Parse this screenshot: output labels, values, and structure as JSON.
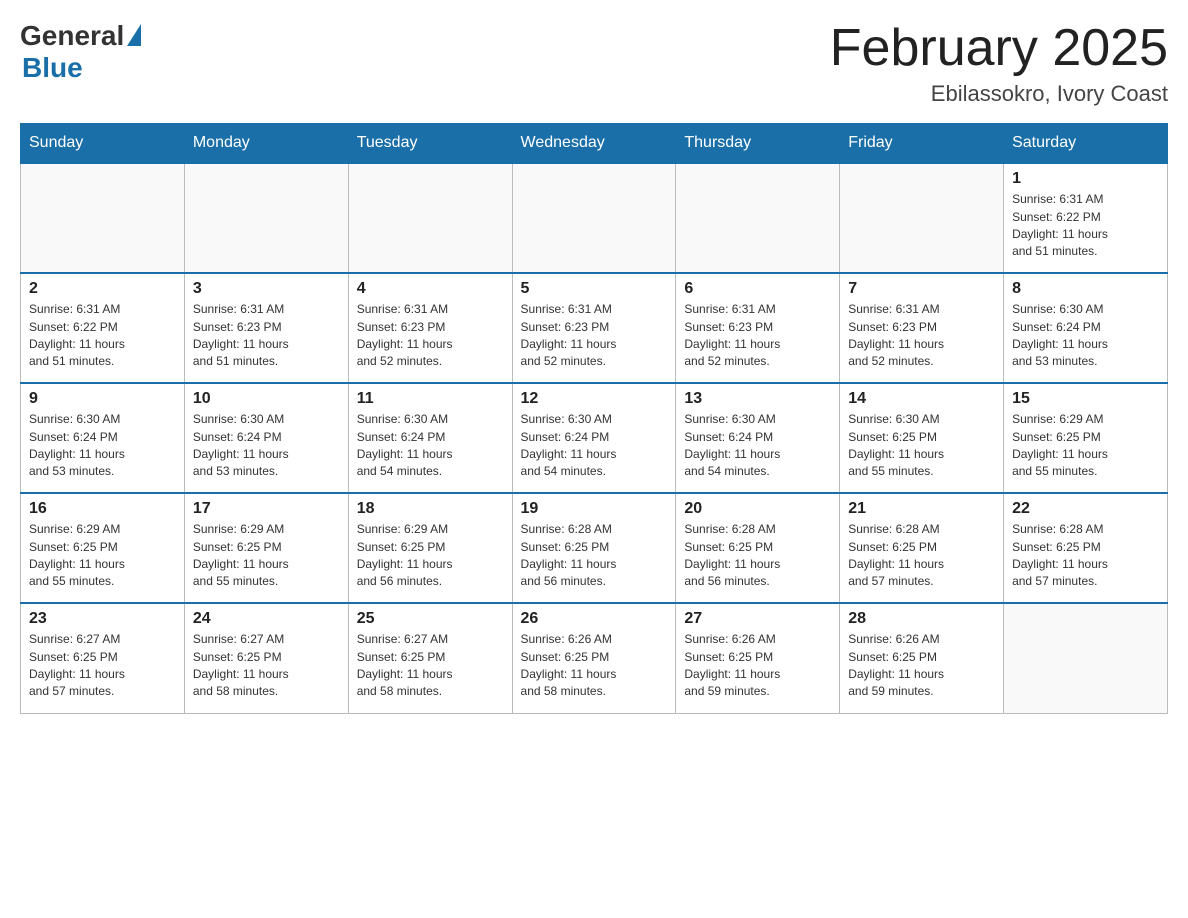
{
  "header": {
    "logo_general": "General",
    "logo_blue": "Blue",
    "month_title": "February 2025",
    "location": "Ebilassokro, Ivory Coast"
  },
  "days_of_week": [
    "Sunday",
    "Monday",
    "Tuesday",
    "Wednesday",
    "Thursday",
    "Friday",
    "Saturday"
  ],
  "weeks": [
    [
      {
        "day": "",
        "info": ""
      },
      {
        "day": "",
        "info": ""
      },
      {
        "day": "",
        "info": ""
      },
      {
        "day": "",
        "info": ""
      },
      {
        "day": "",
        "info": ""
      },
      {
        "day": "",
        "info": ""
      },
      {
        "day": "1",
        "info": "Sunrise: 6:31 AM\nSunset: 6:22 PM\nDaylight: 11 hours\nand 51 minutes."
      }
    ],
    [
      {
        "day": "2",
        "info": "Sunrise: 6:31 AM\nSunset: 6:22 PM\nDaylight: 11 hours\nand 51 minutes."
      },
      {
        "day": "3",
        "info": "Sunrise: 6:31 AM\nSunset: 6:23 PM\nDaylight: 11 hours\nand 51 minutes."
      },
      {
        "day": "4",
        "info": "Sunrise: 6:31 AM\nSunset: 6:23 PM\nDaylight: 11 hours\nand 52 minutes."
      },
      {
        "day": "5",
        "info": "Sunrise: 6:31 AM\nSunset: 6:23 PM\nDaylight: 11 hours\nand 52 minutes."
      },
      {
        "day": "6",
        "info": "Sunrise: 6:31 AM\nSunset: 6:23 PM\nDaylight: 11 hours\nand 52 minutes."
      },
      {
        "day": "7",
        "info": "Sunrise: 6:31 AM\nSunset: 6:23 PM\nDaylight: 11 hours\nand 52 minutes."
      },
      {
        "day": "8",
        "info": "Sunrise: 6:30 AM\nSunset: 6:24 PM\nDaylight: 11 hours\nand 53 minutes."
      }
    ],
    [
      {
        "day": "9",
        "info": "Sunrise: 6:30 AM\nSunset: 6:24 PM\nDaylight: 11 hours\nand 53 minutes."
      },
      {
        "day": "10",
        "info": "Sunrise: 6:30 AM\nSunset: 6:24 PM\nDaylight: 11 hours\nand 53 minutes."
      },
      {
        "day": "11",
        "info": "Sunrise: 6:30 AM\nSunset: 6:24 PM\nDaylight: 11 hours\nand 54 minutes."
      },
      {
        "day": "12",
        "info": "Sunrise: 6:30 AM\nSunset: 6:24 PM\nDaylight: 11 hours\nand 54 minutes."
      },
      {
        "day": "13",
        "info": "Sunrise: 6:30 AM\nSunset: 6:24 PM\nDaylight: 11 hours\nand 54 minutes."
      },
      {
        "day": "14",
        "info": "Sunrise: 6:30 AM\nSunset: 6:25 PM\nDaylight: 11 hours\nand 55 minutes."
      },
      {
        "day": "15",
        "info": "Sunrise: 6:29 AM\nSunset: 6:25 PM\nDaylight: 11 hours\nand 55 minutes."
      }
    ],
    [
      {
        "day": "16",
        "info": "Sunrise: 6:29 AM\nSunset: 6:25 PM\nDaylight: 11 hours\nand 55 minutes."
      },
      {
        "day": "17",
        "info": "Sunrise: 6:29 AM\nSunset: 6:25 PM\nDaylight: 11 hours\nand 55 minutes."
      },
      {
        "day": "18",
        "info": "Sunrise: 6:29 AM\nSunset: 6:25 PM\nDaylight: 11 hours\nand 56 minutes."
      },
      {
        "day": "19",
        "info": "Sunrise: 6:28 AM\nSunset: 6:25 PM\nDaylight: 11 hours\nand 56 minutes."
      },
      {
        "day": "20",
        "info": "Sunrise: 6:28 AM\nSunset: 6:25 PM\nDaylight: 11 hours\nand 56 minutes."
      },
      {
        "day": "21",
        "info": "Sunrise: 6:28 AM\nSunset: 6:25 PM\nDaylight: 11 hours\nand 57 minutes."
      },
      {
        "day": "22",
        "info": "Sunrise: 6:28 AM\nSunset: 6:25 PM\nDaylight: 11 hours\nand 57 minutes."
      }
    ],
    [
      {
        "day": "23",
        "info": "Sunrise: 6:27 AM\nSunset: 6:25 PM\nDaylight: 11 hours\nand 57 minutes."
      },
      {
        "day": "24",
        "info": "Sunrise: 6:27 AM\nSunset: 6:25 PM\nDaylight: 11 hours\nand 58 minutes."
      },
      {
        "day": "25",
        "info": "Sunrise: 6:27 AM\nSunset: 6:25 PM\nDaylight: 11 hours\nand 58 minutes."
      },
      {
        "day": "26",
        "info": "Sunrise: 6:26 AM\nSunset: 6:25 PM\nDaylight: 11 hours\nand 58 minutes."
      },
      {
        "day": "27",
        "info": "Sunrise: 6:26 AM\nSunset: 6:25 PM\nDaylight: 11 hours\nand 59 minutes."
      },
      {
        "day": "28",
        "info": "Sunrise: 6:26 AM\nSunset: 6:25 PM\nDaylight: 11 hours\nand 59 minutes."
      },
      {
        "day": "",
        "info": ""
      }
    ]
  ]
}
